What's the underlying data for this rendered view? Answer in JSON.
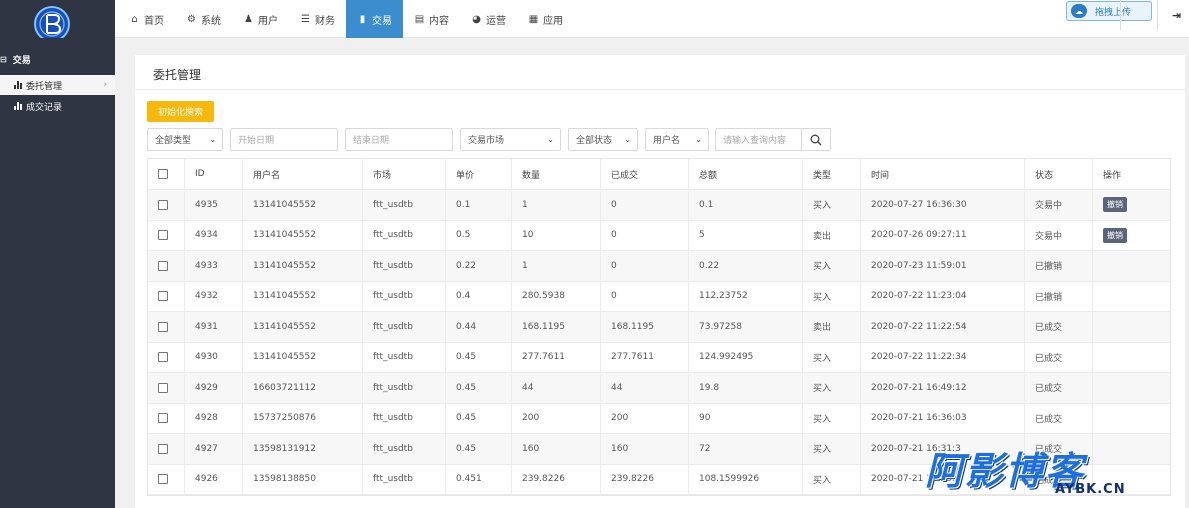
{
  "nav": {
    "items": [
      {
        "label": "首页",
        "icon": "home-icon"
      },
      {
        "label": "系统",
        "icon": "gear-icon"
      },
      {
        "label": "用户",
        "icon": "user-icon"
      },
      {
        "label": "财务",
        "icon": "list-icon"
      },
      {
        "label": "交易",
        "icon": "bar-chart-icon",
        "active": true
      },
      {
        "label": "内容",
        "icon": "document-icon"
      },
      {
        "label": "运营",
        "icon": "globe-icon"
      },
      {
        "label": "应用",
        "icon": "grid-icon"
      }
    ],
    "active_color": "#3c8dce"
  },
  "topright": {
    "upload_label": "拖拽上传"
  },
  "sidebar": {
    "section": "交易",
    "items": [
      {
        "label": "委托管理",
        "active": true
      },
      {
        "label": "成交记录",
        "active": false
      }
    ]
  },
  "panel": {
    "title": "委托管理",
    "init_button": "初始化搜索"
  },
  "filters": {
    "type": "全部类型",
    "start_date_ph": "开始日期",
    "end_date_ph": "结束日期",
    "market": "交易市场",
    "status": "全部状态",
    "username_select": "用户名",
    "query_ph": "请输入查询内容"
  },
  "table": {
    "headers": [
      "ID",
      "用户名",
      "市场",
      "单价",
      "数量",
      "已成交",
      "总额",
      "类型",
      "时间",
      "状态",
      "操作"
    ],
    "rows": [
      [
        "4935",
        "13141045552",
        "ftt_usdtb",
        "0.1",
        "1",
        "0",
        "0.1",
        "买入",
        "2020-07-27 16:36:30",
        "交易中",
        "撤销"
      ],
      [
        "4934",
        "13141045552",
        "ftt_usdtb",
        "0.5",
        "10",
        "0",
        "5",
        "卖出",
        "2020-07-26 09:27:11",
        "交易中",
        "撤销"
      ],
      [
        "4933",
        "13141045552",
        "ftt_usdtb",
        "0.22",
        "1",
        "0",
        "0.22",
        "买入",
        "2020-07-23 11:59:01",
        "已撤销",
        ""
      ],
      [
        "4932",
        "13141045552",
        "ftt_usdtb",
        "0.4",
        "280.5938",
        "0",
        "112.23752",
        "买入",
        "2020-07-22 11:23:04",
        "已撤销",
        ""
      ],
      [
        "4931",
        "13141045552",
        "ftt_usdtb",
        "0.44",
        "168.1195",
        "168.1195",
        "73.97258",
        "卖出",
        "2020-07-22 11:22:54",
        "已成交",
        ""
      ],
      [
        "4930",
        "13141045552",
        "ftt_usdtb",
        "0.45",
        "277.7611",
        "277.7611",
        "124.992495",
        "买入",
        "2020-07-22 11:22:34",
        "已成交",
        ""
      ],
      [
        "4929",
        "16603721112",
        "ftt_usdtb",
        "0.45",
        "44",
        "44",
        "19.8",
        "买入",
        "2020-07-21 16:49:12",
        "已成交",
        ""
      ],
      [
        "4928",
        "15737250876",
        "ftt_usdtb",
        "0.45",
        "200",
        "200",
        "90",
        "买入",
        "2020-07-21 16:36:03",
        "已成交",
        ""
      ],
      [
        "4927",
        "13598131912",
        "ftt_usdtb",
        "0.45",
        "160",
        "160",
        "72",
        "买入",
        "2020-07-21 16:31:3",
        "已成交",
        ""
      ],
      [
        "4926",
        "13598138850",
        "ftt_usdtb",
        "0.451",
        "239.8226",
        "239.8226",
        "108.1599926",
        "买入",
        "2020-07-21 16:29:2",
        "已成交",
        ""
      ]
    ]
  },
  "watermark": {
    "big": "阿影博客",
    "small": "AYBK.CN"
  }
}
